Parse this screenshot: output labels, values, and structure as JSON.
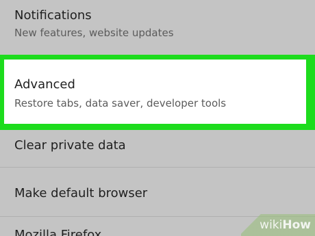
{
  "settings": {
    "items": [
      {
        "title": "Notifications",
        "subtitle": "New features, website updates"
      },
      {
        "title": "Advanced",
        "subtitle": "Restore tabs, data saver, developer tools"
      },
      {
        "title": "Clear private data"
      },
      {
        "title": "Make default browser"
      },
      {
        "title": "Mozilla Firefox"
      }
    ]
  },
  "highlight": {
    "color": "#1ddc1d"
  },
  "watermark": {
    "part1": "wiki",
    "part2": "How"
  }
}
